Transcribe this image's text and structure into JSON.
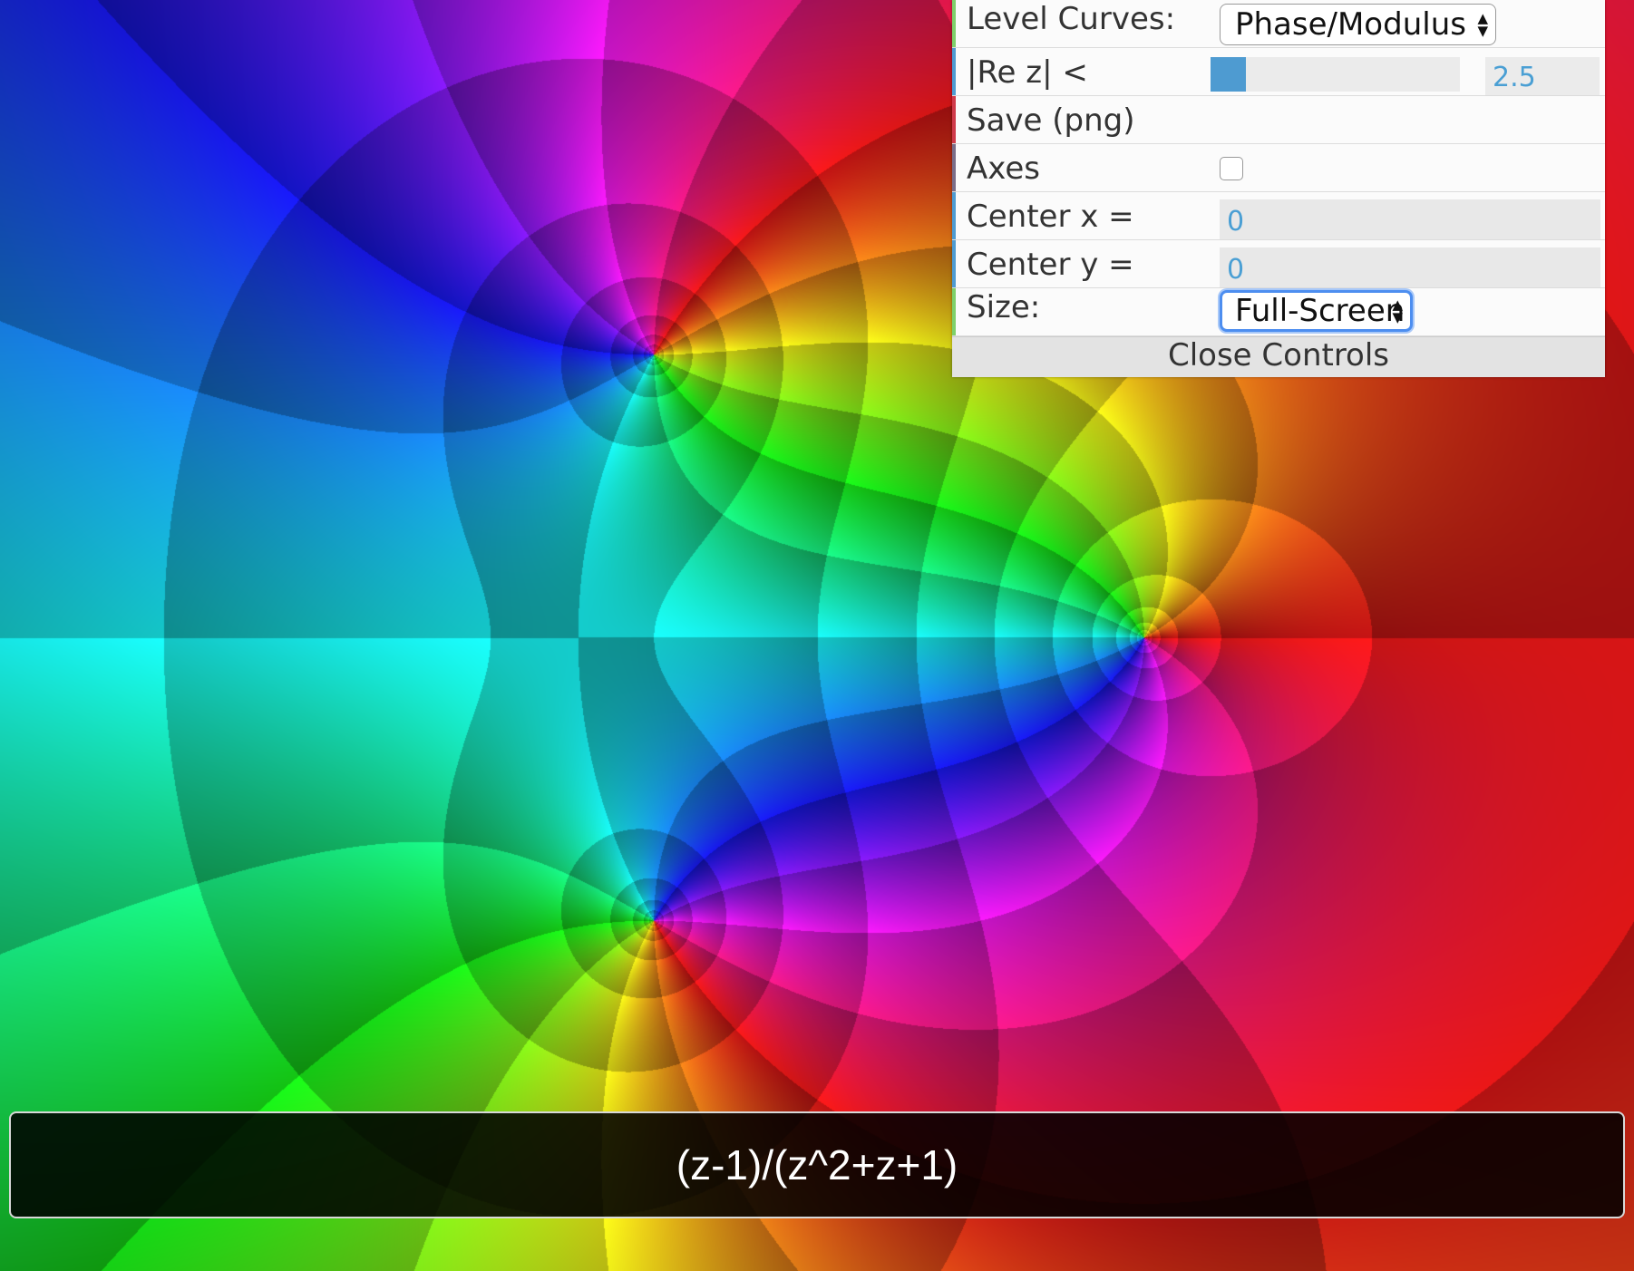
{
  "plot": {
    "function": "(z-1)/(z^2+z+1)",
    "center_x": 0,
    "center_y": 0,
    "re_bound": 2.5,
    "level_curves": "Phase/Modulus",
    "axes_visible": false
  },
  "controls": {
    "level_curves": {
      "label": "Level Curves:",
      "value": "Phase/Modulus",
      "accent": "#7ed06a"
    },
    "re_limit": {
      "label": "|Re z| <",
      "value": "2.5",
      "fraction": 0.14,
      "accent": "#4e9bd1"
    },
    "save": {
      "label": "Save (png)",
      "accent": "#d03a4a"
    },
    "axes": {
      "label": "Axes",
      "checked": false,
      "accent": "#7a6d88"
    },
    "center_x": {
      "label": "Center x =",
      "value": "0",
      "accent": "#4e9bd1"
    },
    "center_y": {
      "label": "Center y =",
      "value": "0",
      "accent": "#4e9bd1"
    },
    "size": {
      "label": "Size:",
      "value": "Full-Screen",
      "accent": "#7ed06a"
    },
    "close": {
      "label": "Close Controls"
    }
  },
  "formula_bar": {
    "text": "(z-1)/(z^2+z+1)"
  }
}
